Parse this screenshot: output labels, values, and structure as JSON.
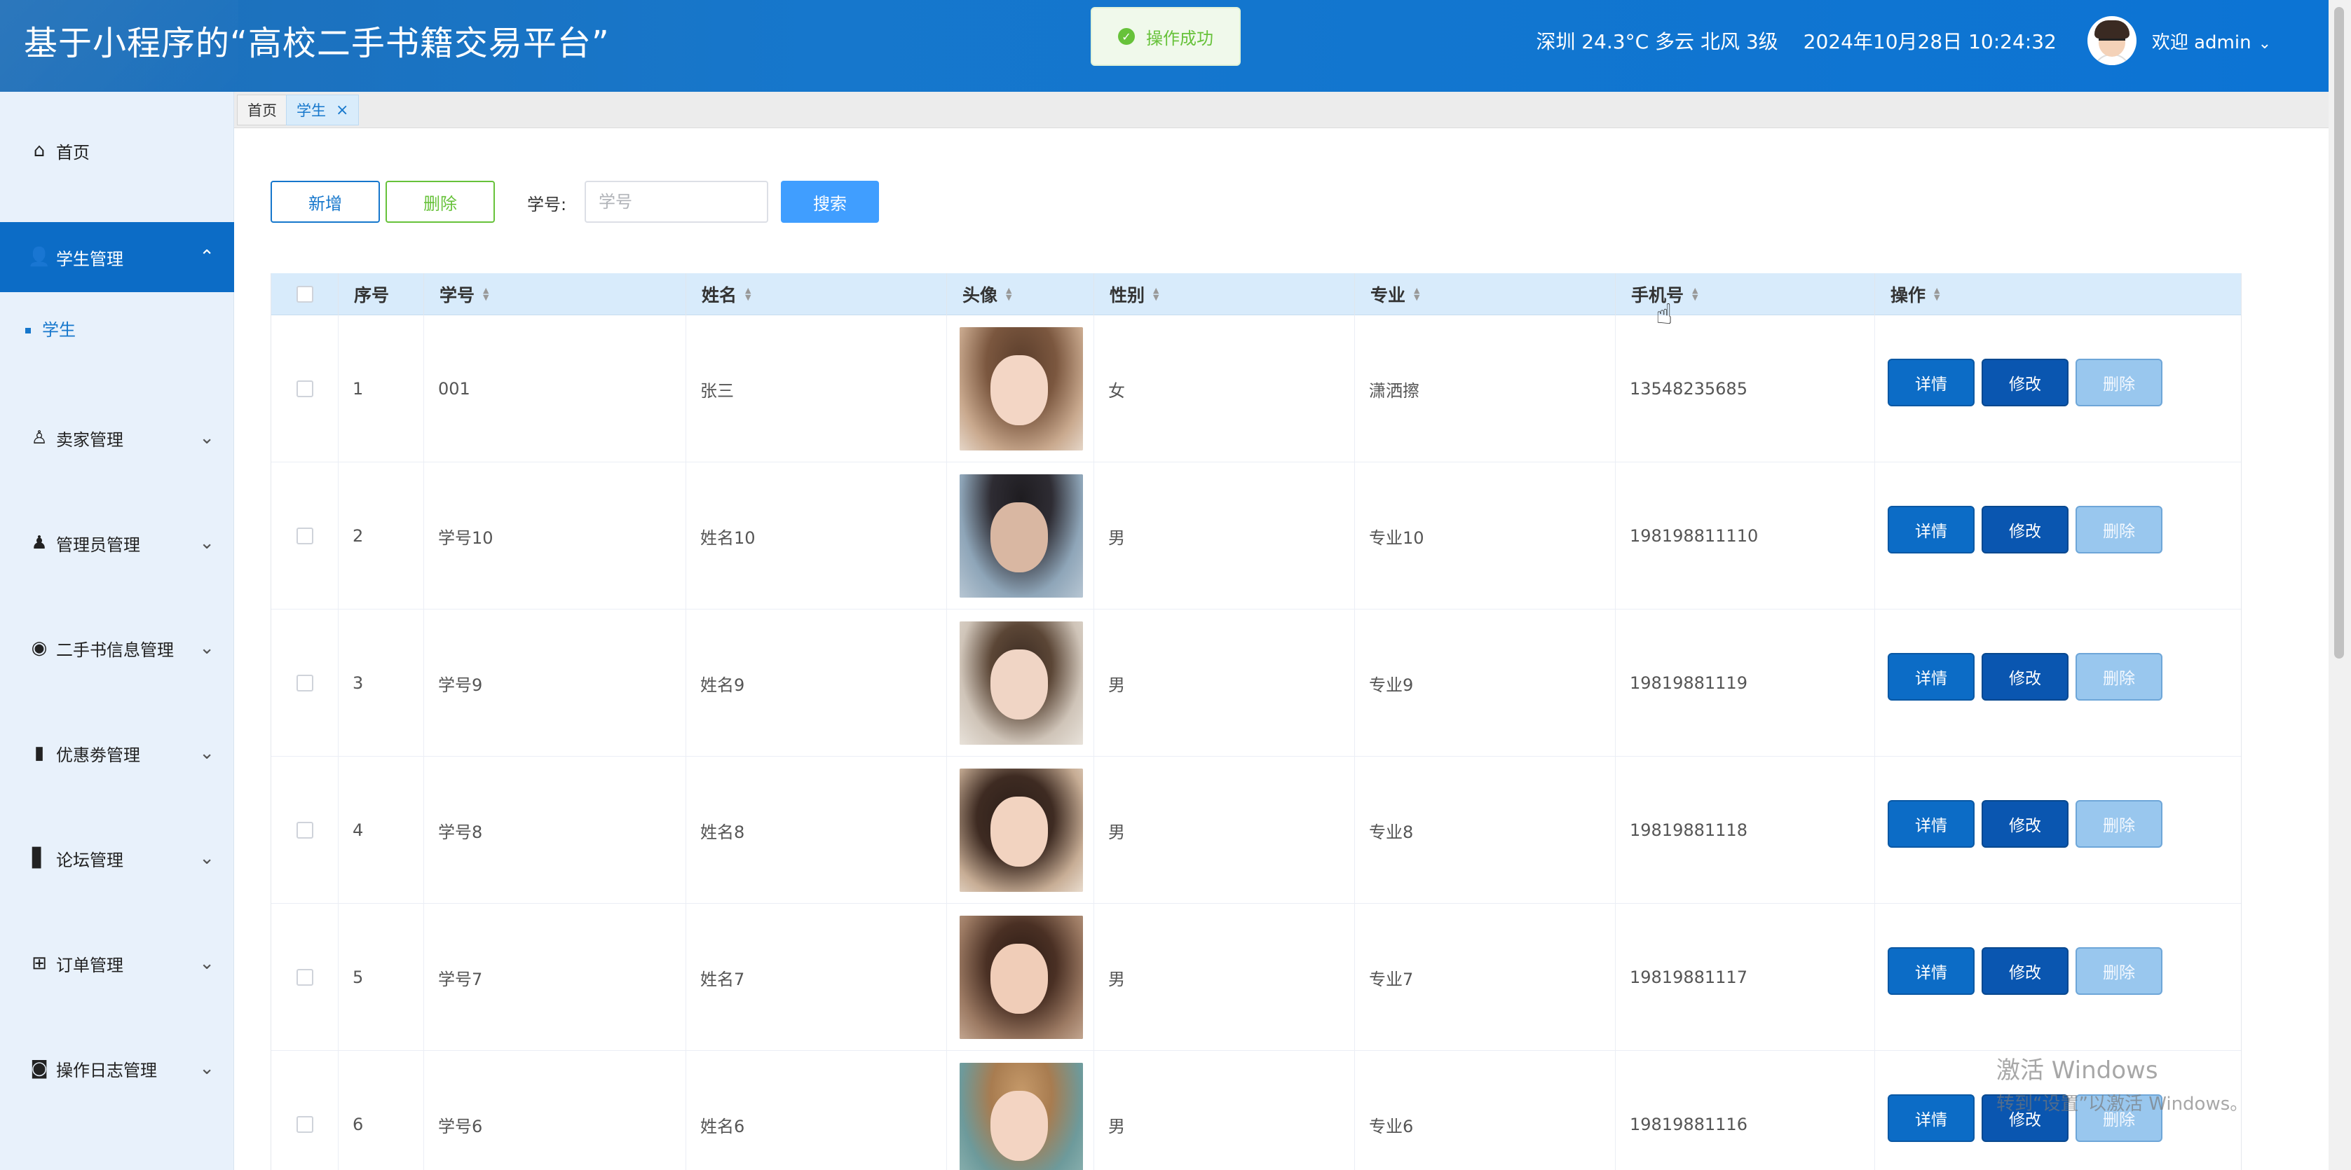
{
  "header": {
    "title": "基于小程序的“高校二手书籍交易平台”",
    "weather": "深圳 24.3°C 多云 北风 3级",
    "datetime": "2024年10月28日 10:24:32",
    "welcome": "欢迎 admin"
  },
  "toast": {
    "message": "操作成功"
  },
  "sidebar": {
    "home": "首页",
    "student_mgmt": "学生管理",
    "student_sub": "学生",
    "seller_mgmt": "卖家管理",
    "admin_mgmt": "管理员管理",
    "book_mgmt": "二手书信息管理",
    "coupon_mgmt": "优惠劵管理",
    "forum_mgmt": "论坛管理",
    "order_mgmt": "订单管理",
    "log_mgmt": "操作日志管理"
  },
  "tabs": {
    "home": "首页",
    "student": "学生",
    "close": "×"
  },
  "toolbar": {
    "add": "新增",
    "delete": "删除",
    "sid_label": "学号:",
    "sid_placeholder": "学号",
    "search": "搜索"
  },
  "table": {
    "headers": {
      "index": "序号",
      "sid": "学号",
      "name": "姓名",
      "avatar": "头像",
      "gender": "性别",
      "major": "专业",
      "phone": "手机号",
      "ops": "操作"
    },
    "op_labels": {
      "detail": "详情",
      "edit": "修改",
      "delete": "删除"
    },
    "rows": [
      {
        "index": "1",
        "sid": "001",
        "name": "张三",
        "gender": "女",
        "major": "潇洒擦",
        "phone": "13548235685"
      },
      {
        "index": "2",
        "sid": "学号10",
        "name": "姓名10",
        "gender": "男",
        "major": "专业10",
        "phone": "198198811110"
      },
      {
        "index": "3",
        "sid": "学号9",
        "name": "姓名9",
        "gender": "男",
        "major": "专业9",
        "phone": "19819881119"
      },
      {
        "index": "4",
        "sid": "学号8",
        "name": "姓名8",
        "gender": "男",
        "major": "专业8",
        "phone": "19819881118"
      },
      {
        "index": "5",
        "sid": "学号7",
        "name": "姓名7",
        "gender": "男",
        "major": "专业7",
        "phone": "19819881117"
      },
      {
        "index": "6",
        "sid": "学号6",
        "name": "姓名6",
        "gender": "男",
        "major": "专业6",
        "phone": "19819881116"
      }
    ]
  },
  "watermark": {
    "line1": "激活 Windows",
    "line2": "转到“设置”以激活 Windows。"
  }
}
